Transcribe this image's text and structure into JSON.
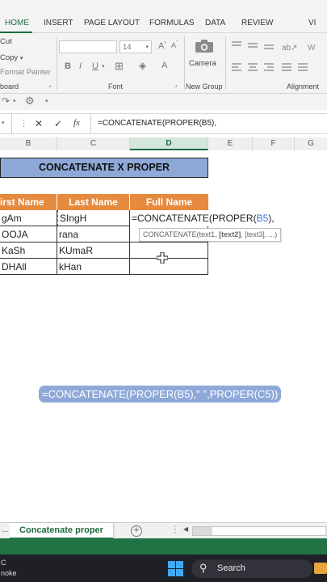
{
  "ribbon": {
    "tabs": [
      "HOME",
      "INSERT",
      "PAGE LAYOUT",
      "FORMULAS",
      "DATA",
      "REVIEW",
      "VI"
    ],
    "clipboard": {
      "cut": "Cut",
      "copy": "Copy",
      "format_painter": "Format Painter",
      "label": "board"
    },
    "font": {
      "font_size": "14",
      "bold": "B",
      "italic": "I",
      "underline": "U",
      "grow": "A",
      "shrink": "A",
      "label": "Font"
    },
    "new_group": {
      "camera": "Camera",
      "label": "New Group"
    },
    "alignment": {
      "label": "Alignment"
    }
  },
  "formula_bar": {
    "cancel": "✕",
    "enter": "✓",
    "fx": "fx",
    "content": "=CONCATENATE(PROPER(B5),"
  },
  "columns": [
    "B",
    "C",
    "D",
    "E",
    "F",
    "G"
  ],
  "sheet": {
    "title": "CONCATENATE  X  PROPER",
    "headers": [
      "irst Name",
      "Last Name",
      "Full Name"
    ],
    "rows": [
      [
        "gAm",
        "SIngH"
      ],
      [
        "OOJA",
        "rana"
      ],
      [
        "KaSh",
        "KUmaR"
      ],
      [
        "DHAll",
        "kHan"
      ]
    ],
    "editing_formula_prefix": "=CONCATENATE(PROPER(",
    "editing_formula_ref": "B5",
    "editing_formula_suffix": "),",
    "tooltip_func": "CONCATENATE(text1, ",
    "tooltip_arg_bold": "[text2]",
    "tooltip_rest": ", [text3], ...)",
    "formula_pill": "=CONCATENATE(PROPER(B5),\" \",PROPER(C5))"
  },
  "sheet_tabs": {
    "more": "...",
    "active": "Concatenate proper",
    "add": "+"
  },
  "taskbar": {
    "search": "Search",
    "left1": "C",
    "left2": "noke"
  },
  "colors": {
    "excel_green": "#217346",
    "header_orange": "#e58a3f",
    "banner_blue": "#8ea9d8",
    "ref_blue": "#3b6fd6"
  }
}
